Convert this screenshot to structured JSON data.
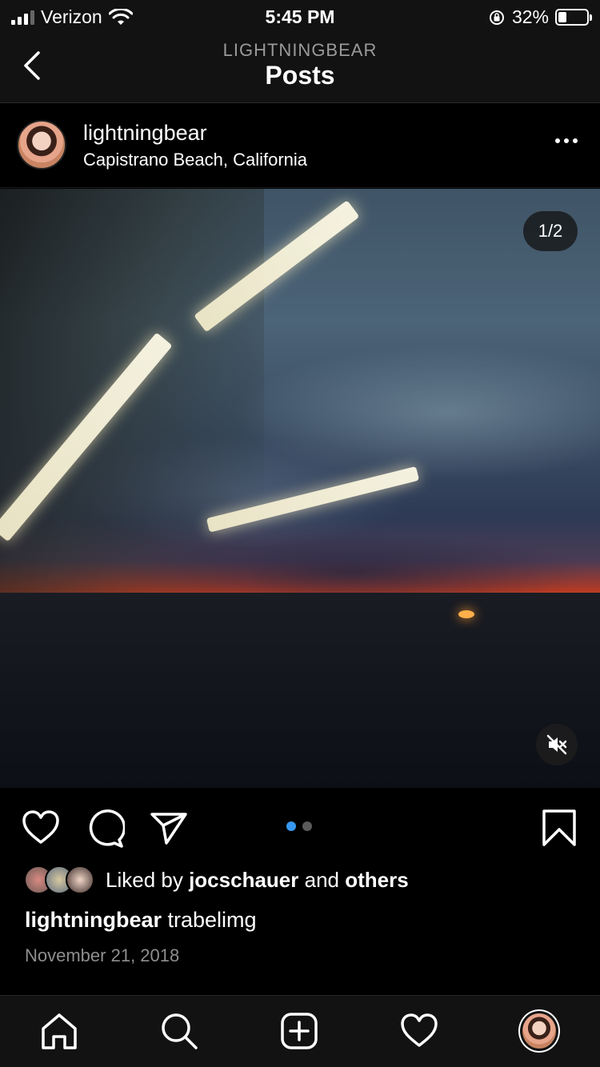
{
  "status_bar": {
    "carrier": "Verizon",
    "time": "5:45 PM",
    "battery": "32%"
  },
  "nav": {
    "subtitle": "LIGHTNINGBEAR",
    "title": "Posts"
  },
  "post": {
    "username": "lightningbear",
    "location": "Capistrano Beach, California",
    "media_counter": "1/2",
    "liked_by_prefix": "Liked by",
    "liked_by_user": "jocschauer",
    "liked_by_and": "and",
    "liked_by_others": "others",
    "caption_user": "lightningbear",
    "caption_text": "trabelimg",
    "date": "November 21, 2018"
  },
  "carousel": {
    "total": 2,
    "active": 1
  },
  "icons": {
    "back": "chevron-left-icon",
    "more": "more-icon",
    "like": "heart-icon",
    "comment": "comment-icon",
    "share": "send-icon",
    "save": "bookmark-icon",
    "mute": "mute-icon",
    "home": "home-icon",
    "search": "search-icon",
    "create": "plus-square-icon",
    "activity": "heart-icon"
  },
  "colors": {
    "accent": "#3897f0",
    "background": "#000000",
    "bar": "#121212"
  }
}
